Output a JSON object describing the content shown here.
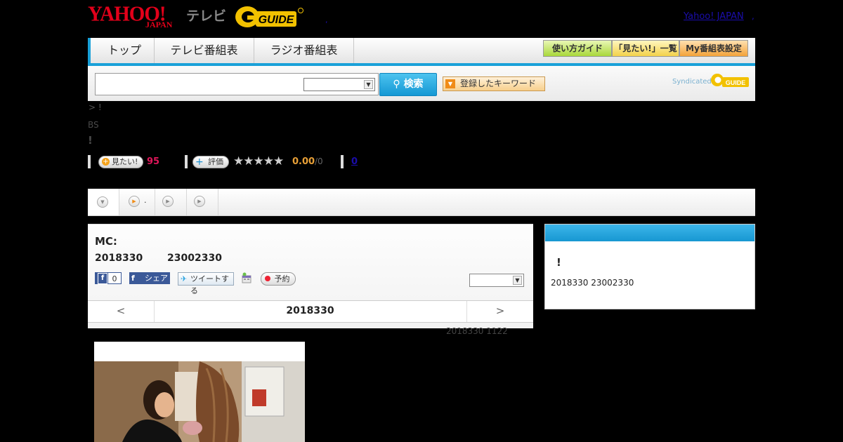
{
  "header": {
    "yahoo_logo": "YAHOO!",
    "yahoo_japan": "JAPAN",
    "tv_label": "テレビ",
    "gguide_logo": "G-GUIDE",
    "yahoo_japan_link": "Yahoo! JAPAN",
    "dot1": ",",
    "dot2": ","
  },
  "nav": {
    "tabs": [
      {
        "label": "トップ"
      },
      {
        "label": "テレビ番組表"
      },
      {
        "label": "ラジオ番組表"
      }
    ],
    "right_buttons": [
      {
        "label": "使い方ガイド"
      },
      {
        "label": "「見たい!」一覧"
      },
      {
        "label": "My番組表設定"
      }
    ]
  },
  "search": {
    "input_value": "",
    "select_value": "",
    "search_button": "検索",
    "keyword_button": "登録したキーワード",
    "syndicated": "Syndicated",
    "gguide": "GUIDE"
  },
  "program": {
    "breadcrumb": "> !",
    "channel": "BS",
    "title": "!",
    "mitai_label": "見たい!",
    "mitai_count": "95",
    "rate_label": "評価",
    "stars": "★★★★★",
    "rating": "0.00",
    "rating_count": "/0",
    "zero_link": "0"
  },
  "tabs": {
    "tab2_text": "."
  },
  "main": {
    "mc": "MC:",
    "date": "2018330",
    "time": "23002330",
    "fb_like_count": "0",
    "fb_share": "シェア",
    "tweet": "ツイートする",
    "reserve": "予約",
    "select_value": "",
    "pager_prev": "<",
    "pager_date": "2018330",
    "pager_next": ">",
    "updated": "2018330  1122"
  },
  "side": {
    "title": "!",
    "datetime": "2018330  23002330"
  },
  "colors": {
    "accent_blue": "#19a0d8",
    "yahoo_red": "#e2001a",
    "gguide_yellow": "#f2c100",
    "mitai_pink": "#e0165a",
    "rating_orange": "#e8a037"
  }
}
